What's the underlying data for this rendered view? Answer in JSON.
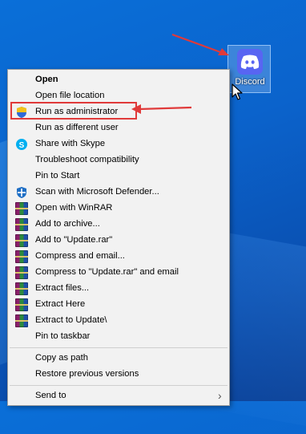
{
  "desktop": {
    "icon_label": "Discord"
  },
  "menu": {
    "items": [
      {
        "label": "Open"
      },
      {
        "label": "Open file location"
      },
      {
        "label": "Run as administrator"
      },
      {
        "label": "Run as different user"
      },
      {
        "label": "Share with Skype"
      },
      {
        "label": "Troubleshoot compatibility"
      },
      {
        "label": "Pin to Start"
      },
      {
        "label": "Scan with Microsoft Defender..."
      },
      {
        "label": "Open with WinRAR"
      },
      {
        "label": "Add to archive..."
      },
      {
        "label": "Add to \"Update.rar\""
      },
      {
        "label": "Compress and email..."
      },
      {
        "label": "Compress to \"Update.rar\" and email"
      },
      {
        "label": "Extract files..."
      },
      {
        "label": "Extract Here"
      },
      {
        "label": "Extract to Update\\"
      },
      {
        "label": "Pin to taskbar"
      },
      {
        "label": "Copy as path"
      },
      {
        "label": "Restore previous versions"
      },
      {
        "label": "Send to"
      }
    ]
  },
  "annotation_color": "#e03a3a"
}
